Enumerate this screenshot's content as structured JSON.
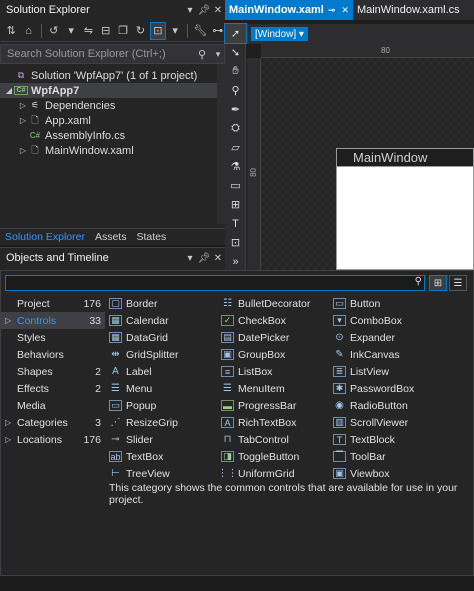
{
  "solution_explorer": {
    "title": "Solution Explorer",
    "search_placeholder": "Search Solution Explorer (Ctrl+;)",
    "tree": [
      {
        "label": "Solution 'WpfApp7' (1 of 1 project)",
        "icon": "solution-icon"
      },
      {
        "label": "WpfApp7",
        "icon": "csharp-project-icon"
      },
      {
        "label": "Dependencies",
        "icon": "dependencies-icon"
      },
      {
        "label": "App.xaml",
        "icon": "xaml-file-icon"
      },
      {
        "label": "AssemblyInfo.cs",
        "icon": "csharp-file-icon"
      },
      {
        "label": "MainWindow.xaml",
        "icon": "xaml-file-icon"
      }
    ],
    "tabs": [
      "Solution Explorer",
      "Assets",
      "States"
    ]
  },
  "objects_timeline": {
    "title": "Objects and Timeline"
  },
  "designer": {
    "tabs": [
      {
        "label": "MainWindow.xaml",
        "active": true
      },
      {
        "label": "MainWindow.xaml.cs",
        "active": false
      }
    ],
    "scope": "[Window]",
    "ruler_top": "80",
    "ruler_left": "80",
    "window_title": "MainWindow"
  },
  "assets": {
    "categories": [
      {
        "label": "Project",
        "count": "176",
        "expandable": false
      },
      {
        "label": "Controls",
        "count": "33",
        "expandable": true,
        "selected": true
      },
      {
        "label": "Styles",
        "count": "",
        "expandable": false
      },
      {
        "label": "Behaviors",
        "count": "",
        "expandable": false
      },
      {
        "label": "Shapes",
        "count": "2",
        "expandable": false
      },
      {
        "label": "Effects",
        "count": "2",
        "expandable": false
      },
      {
        "label": "Media",
        "count": "",
        "expandable": false
      },
      {
        "label": "Categories",
        "count": "3",
        "expandable": true
      },
      {
        "label": "Locations",
        "count": "176",
        "expandable": true
      }
    ],
    "controls": [
      "Border",
      "BulletDecorator",
      "Button",
      "Calendar",
      "CheckBox",
      "ComboBox",
      "DataGrid",
      "DatePicker",
      "Expander",
      "GridSplitter",
      "GroupBox",
      "InkCanvas",
      "Label",
      "ListBox",
      "ListView",
      "Menu",
      "MenuItem",
      "PasswordBox",
      "Popup",
      "ProgressBar",
      "RadioButton",
      "ResizeGrip",
      "RichTextBox",
      "ScrollViewer",
      "Slider",
      "TabControl",
      "TextBlock",
      "TextBox",
      "ToggleButton",
      "ToolBar",
      "TreeView",
      "UniformGrid",
      "Viewbox"
    ],
    "description": "This category shows the common controls that are available for use in your project."
  },
  "colors": {
    "accent": "#007acc",
    "background": "#1b1b1c",
    "panel": "#252526"
  }
}
